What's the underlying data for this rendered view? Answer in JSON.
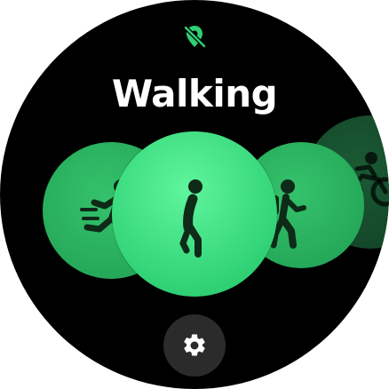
{
  "screen": {
    "title": "Walking",
    "background": "#000000",
    "accent": "#2ed073"
  },
  "status": {
    "icon": "location-off-icon"
  },
  "workouts": [
    {
      "icon": "running-icon",
      "state": "side-left"
    },
    {
      "icon": "walking-icon",
      "state": "selected"
    },
    {
      "icon": "hiking-icon",
      "state": "side-right"
    },
    {
      "icon": "cycling-icon",
      "state": "far-right"
    }
  ],
  "settings": {
    "icon": "gear-icon"
  }
}
